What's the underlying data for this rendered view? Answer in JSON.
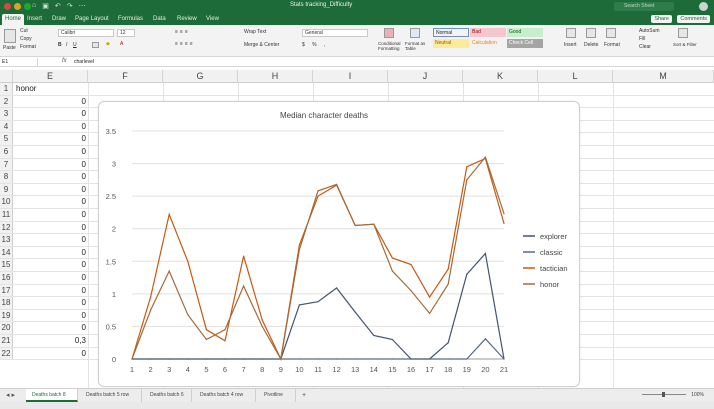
{
  "titlebar": {
    "document_title": "Stats tracking_Difficulty",
    "search_placeholder": "Search Sheet"
  },
  "ribbon_tabs": [
    "Home",
    "Insert",
    "Draw",
    "Page Layout",
    "Formulas",
    "Data",
    "Review",
    "View"
  ],
  "ribbon_actions": {
    "share": "Share",
    "comments": "Comments"
  },
  "ribbon": {
    "paste": "Paste",
    "cut": "Cut",
    "copy": "Copy",
    "format": "Format",
    "font_name": "Calibri",
    "font_size": "12",
    "wrap_text": "Wrap Text",
    "merge_center": "Merge & Center",
    "number_format": "General",
    "conditional_formatting": "Conditional Formatting",
    "format_as_table": "Format as Table",
    "styles": [
      {
        "label": "Normal",
        "bg": "#ffffff"
      },
      {
        "label": "Bad",
        "bg": "#f4c7ce"
      },
      {
        "label": "Good",
        "bg": "#c7ecce"
      },
      {
        "label": "Neutral",
        "bg": "#fdeb9c"
      },
      {
        "label": "Calculation",
        "bg": "#f2f2f2"
      },
      {
        "label": "Check Cell",
        "bg": "#a5a5a5"
      }
    ],
    "insert": "Insert",
    "delete": "Delete",
    "format_cells": "Format",
    "autosum": "AutoSum",
    "fill": "Fill",
    "clear": "Clear",
    "sort_filter": "Sort & Filter"
  },
  "formula_bar": {
    "name_box": "E1",
    "fx": "fx",
    "content": "charlevel"
  },
  "columns": [
    "E",
    "F",
    "G",
    "H",
    "I",
    "J",
    "K",
    "L",
    "M"
  ],
  "rows": [
    {
      "n": "1",
      "e": "honor"
    },
    {
      "n": "2",
      "e": "0"
    },
    {
      "n": "3",
      "e": "0"
    },
    {
      "n": "4",
      "e": "0"
    },
    {
      "n": "5",
      "e": "0"
    },
    {
      "n": "6",
      "e": "0"
    },
    {
      "n": "7",
      "e": "0"
    },
    {
      "n": "8",
      "e": "0"
    },
    {
      "n": "9",
      "e": "0"
    },
    {
      "n": "10",
      "e": "0"
    },
    {
      "n": "11",
      "e": "0"
    },
    {
      "n": "12",
      "e": "0"
    },
    {
      "n": "13",
      "e": "0"
    },
    {
      "n": "14",
      "e": "0"
    },
    {
      "n": "15",
      "e": "0"
    },
    {
      "n": "16",
      "e": "0"
    },
    {
      "n": "17",
      "e": "0"
    },
    {
      "n": "18",
      "e": "0"
    },
    {
      "n": "19",
      "e": "0"
    },
    {
      "n": "20",
      "e": "0"
    },
    {
      "n": "21",
      "e": "0,3"
    },
    {
      "n": "22",
      "e": "0"
    }
  ],
  "sheet_tabs": [
    {
      "label": "Deaths batch 8",
      "active": true
    },
    {
      "label": "Deaths batch 5 row",
      "active": false
    },
    {
      "label": "Deaths batch 6",
      "active": false
    },
    {
      "label": "Deaths batch 4 row",
      "active": false
    },
    {
      "label": "Pivotline",
      "active": false
    }
  ],
  "add_sheet": "+",
  "zoom_percent": "100%",
  "chart_data": {
    "type": "line",
    "title": "Median character deaths",
    "xlabel": "",
    "ylabel": "",
    "x": [
      1,
      2,
      3,
      4,
      5,
      6,
      7,
      8,
      9,
      10,
      11,
      12,
      13,
      14,
      15,
      16,
      17,
      18,
      19,
      20,
      21
    ],
    "ylim": [
      0,
      3.5
    ],
    "yticks": [
      "0",
      "0.5",
      "1",
      "1.5",
      "2",
      "2.5",
      "3",
      "3.5"
    ],
    "grid": true,
    "legend_position": "right",
    "series": [
      {
        "name": "explorer",
        "color": "#44546a",
        "values": [
          0,
          0,
          0,
          0,
          0,
          0,
          0,
          0,
          0,
          0.83,
          0.88,
          1.09,
          0.72,
          0.36,
          0.3,
          0,
          0,
          0.25,
          1.3,
          1.62,
          0
        ]
      },
      {
        "name": "classic",
        "color": "#5a6a82",
        "values": [
          0,
          0,
          0,
          0,
          0,
          0,
          0,
          0,
          0,
          0,
          0,
          0,
          0,
          0,
          0,
          0,
          0,
          0,
          0,
          0.31,
          0
        ]
      },
      {
        "name": "tactician",
        "color": "#c55a11",
        "values": [
          0,
          0.95,
          2.22,
          1.5,
          0.45,
          0.28,
          1.58,
          0.6,
          0,
          1.75,
          2.5,
          2.67,
          2.05,
          2.07,
          1.55,
          1.45,
          0.95,
          1.38,
          2.95,
          3.08,
          2.08
        ]
      },
      {
        "name": "honor",
        "color": "#a36b3a",
        "values": [
          0,
          0.75,
          1.35,
          0.68,
          0.3,
          0.45,
          1.12,
          0.5,
          0,
          1.68,
          2.58,
          2.68,
          2.05,
          2.07,
          1.35,
          1.05,
          0.7,
          1.15,
          2.75,
          3.1,
          2.23
        ]
      }
    ]
  }
}
